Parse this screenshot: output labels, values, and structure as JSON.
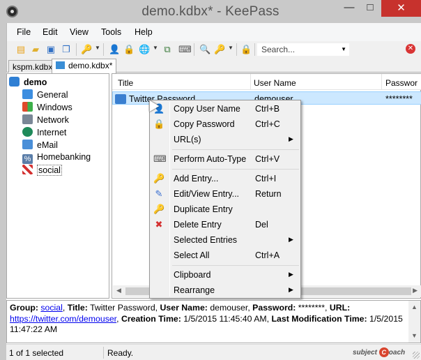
{
  "window": {
    "title": "demo.kdbx* - KeePass",
    "minimize": "—",
    "maximize": "□",
    "close": "✕"
  },
  "menu": [
    "File",
    "Edit",
    "View",
    "Tools",
    "Help"
  ],
  "toolbar": {
    "search_placeholder": "Search..."
  },
  "tabs": [
    {
      "label": "kspm.kdbx",
      "active": false
    },
    {
      "label": "demo.kdbx*",
      "active": true
    }
  ],
  "tree": {
    "root": "demo",
    "groups": [
      "General",
      "Windows",
      "Network",
      "Internet",
      "eMail",
      "Homebanking",
      "social"
    ],
    "selected": "social"
  },
  "list": {
    "columns": [
      "Title",
      "User Name",
      "Passwor"
    ],
    "entries": [
      {
        "title": "Twitter Password",
        "user": "demouser",
        "password": "********"
      }
    ]
  },
  "context_menu": {
    "items": [
      {
        "label": "Copy User Name",
        "shortcut": "Ctrl+B",
        "icon": "user-icon"
      },
      {
        "label": "Copy Password",
        "shortcut": "Ctrl+C",
        "icon": "key-icon"
      },
      {
        "label": "URL(s)",
        "shortcut": "",
        "submenu": true
      },
      {
        "label": "Perform Auto-Type",
        "shortcut": "Ctrl+V",
        "icon": "keyboard-icon"
      },
      {
        "label": "Add Entry...",
        "shortcut": "Ctrl+I",
        "icon": "add-key-icon"
      },
      {
        "label": "Edit/View Entry...",
        "shortcut": "Return",
        "icon": "edit-key-icon"
      },
      {
        "label": "Duplicate Entry",
        "shortcut": "",
        "icon": "duplicate-key-icon"
      },
      {
        "label": "Delete Entry",
        "shortcut": "Del",
        "icon": "delete-key-icon"
      },
      {
        "label": "Selected Entries",
        "shortcut": "",
        "submenu": true
      },
      {
        "label": "Select All",
        "shortcut": "Ctrl+A"
      },
      {
        "label": "Clipboard",
        "shortcut": "",
        "submenu": true
      },
      {
        "label": "Rearrange",
        "shortcut": "",
        "submenu": true
      }
    ]
  },
  "details": {
    "group_label": "Group:",
    "group": "social",
    "title_label": "Title:",
    "title": "Twitter Password,",
    "user_label": "User Name:",
    "user": "demouser,",
    "password_label": "Password:",
    "password": "********,",
    "url_label": "URL:",
    "url": "https://twitter.com/demouser",
    "creation_label": "Creation Time:",
    "creation": "1/5/2015 11:45:40 AM,",
    "mod_label": "Last Modification Time:",
    "mod_part1": "1/5/2015",
    "mod_part2": "11:47:22 AM"
  },
  "status": {
    "selection": "1 of 1 selected",
    "state": "Ready.",
    "watermark_left": "subject",
    "watermark_c": "C",
    "watermark_right": "oach"
  },
  "colors": {
    "selection": "#cce8ff",
    "close_button": "#c7322d",
    "link": "#0000ee"
  }
}
